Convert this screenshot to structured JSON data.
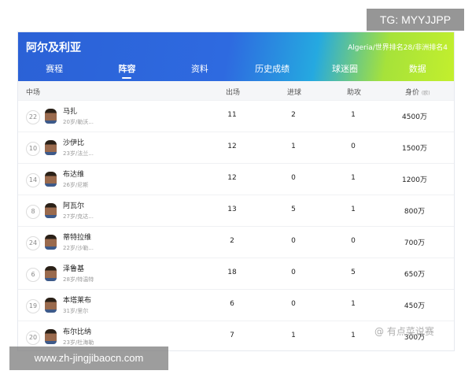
{
  "header": {
    "team_name": "阿尔及利亚",
    "rank_text": "Algeria/世界排名28/非洲排名4",
    "tabs": [
      {
        "label": "赛程",
        "active": false
      },
      {
        "label": "阵容",
        "active": true
      },
      {
        "label": "资料",
        "active": false
      },
      {
        "label": "历史成绩",
        "active": false
      },
      {
        "label": "球迷圈",
        "active": false
      },
      {
        "label": "数据",
        "active": false
      }
    ]
  },
  "table": {
    "columns": {
      "position": "中场",
      "appearances": "出场",
      "goals": "进球",
      "assists": "助攻",
      "value": "身价",
      "value_unit": "(欧)"
    },
    "rows": [
      {
        "number": "22",
        "name": "马扎",
        "info": "20岁/勒沃...",
        "appearances": "11",
        "goals": "2",
        "assists": "1",
        "value": "4500万"
      },
      {
        "number": "10",
        "name": "沙伊比",
        "info": "23岁/法兰...",
        "appearances": "12",
        "goals": "1",
        "assists": "0",
        "value": "1500万"
      },
      {
        "number": "14",
        "name": "布达维",
        "info": "26岁/尼斯",
        "appearances": "12",
        "goals": "0",
        "assists": "1",
        "value": "1200万"
      },
      {
        "number": "8",
        "name": "阿瓦尔",
        "info": "27岁/克达...",
        "appearances": "13",
        "goals": "5",
        "assists": "1",
        "value": "800万"
      },
      {
        "number": "24",
        "name": "蒂特拉维",
        "info": "22岁/沙勒...",
        "appearances": "2",
        "goals": "0",
        "assists": "0",
        "value": "700万"
      },
      {
        "number": "6",
        "name": "泽鲁基",
        "info": "28岁/特温特",
        "appearances": "18",
        "goals": "0",
        "assists": "5",
        "value": "650万"
      },
      {
        "number": "19",
        "name": "本塔莱布",
        "info": "31岁/里尔",
        "appearances": "6",
        "goals": "0",
        "assists": "1",
        "value": "450万"
      },
      {
        "number": "20",
        "name": "布尔比纳",
        "info": "23岁/杜海勒",
        "appearances": "7",
        "goals": "1",
        "assists": "1",
        "value": "300万"
      }
    ]
  },
  "overlays": {
    "tg": "TG: MYYJJPP",
    "url": "www.zh-jingjibaocn.com",
    "watermark": "@ 有点菜说赛"
  },
  "colors": {
    "header_blue": "#2b61d6",
    "header_green": "#c3ef2d",
    "row_border": "#f0f1f4",
    "colhead_bg": "#f5f6f8"
  }
}
